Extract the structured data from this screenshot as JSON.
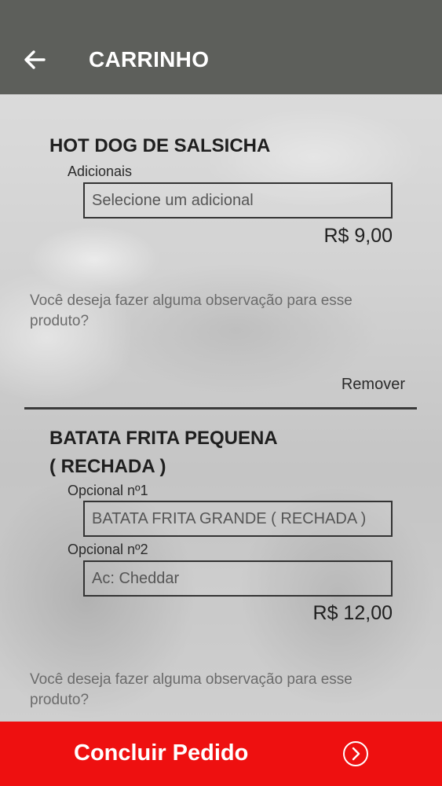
{
  "appbar": {
    "title": "CARRINHO",
    "back_icon": "arrow-left-icon"
  },
  "cart_items": [
    {
      "name_lines": [
        "HOT DOG DE SALSICHA"
      ],
      "options": [
        {
          "label": "Adicionais",
          "value": "Selecione um adicional"
        }
      ],
      "price": "R$ 9,00",
      "observation_placeholder": "Você deseja fazer alguma observação para esse produto?",
      "remove_label": "Remover"
    },
    {
      "name_lines": [
        "BATATA FRITA PEQUENA",
        "( RECHADA )"
      ],
      "options": [
        {
          "label": "Opcional nº1",
          "value": "BATATA FRITA GRANDE ( RECHADA )"
        },
        {
          "label": "Opcional nº2",
          "value": "Ac: Cheddar"
        }
      ],
      "price": "R$ 12,00",
      "observation_placeholder": "Você deseja fazer alguma observação para esse produto?"
    }
  ],
  "checkout": {
    "label": "Concluir Pedido",
    "icon": "chevron-right-circle-icon"
  },
  "colors": {
    "appbar": "#5d5f5b",
    "checkout": "#ee1010"
  }
}
